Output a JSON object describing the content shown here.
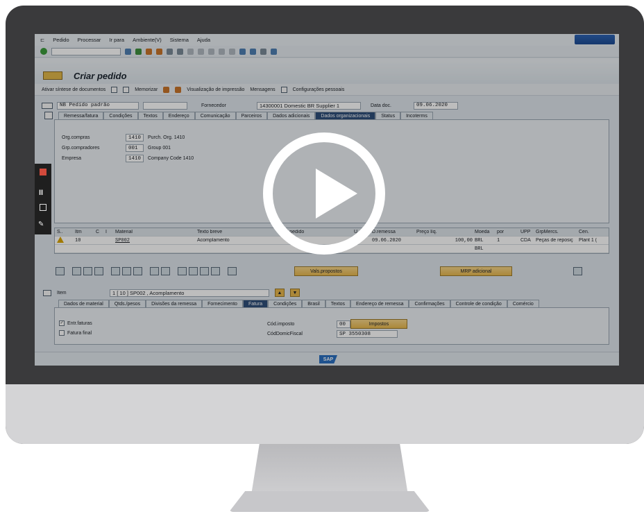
{
  "menu": [
    "Pedido",
    "Processar",
    "Ir para",
    "Ambiente(V)",
    "Sistema",
    "Ajuda"
  ],
  "title": "Criar pedido",
  "app_toolbar": {
    "doc_overview": "Ativar síntese de documentos",
    "hold": "Memorizar",
    "print_preview": "Visualização de impressão",
    "messages": "Mensagens",
    "personal_settings": "Configurações pessoais"
  },
  "header": {
    "order_type": "NB Pedido padrão",
    "supplier_label": "Fornecedor",
    "supplier_value": "14300001 Domestic BR Supplier 1",
    "doc_date_label": "Data doc.",
    "doc_date_value": "09.06.2020"
  },
  "header_tabs": [
    "Remessa/fatura",
    "Condições",
    "Textos",
    "Endereço",
    "Comunicação",
    "Parceiros",
    "Dados adicionais",
    "Dados organizacionais",
    "Status",
    "Incoterms"
  ],
  "org": [
    {
      "label": "Org.compras",
      "value": "1410",
      "desc": "Purch. Org. 1410"
    },
    {
      "label": "Grp.compradores",
      "value": "001",
      "desc": "Group 001"
    },
    {
      "label": "Empresa",
      "value": "1410",
      "desc": "Company Code 1410"
    }
  ],
  "items_table": {
    "headers": [
      "S..",
      "Itm",
      "C",
      "I",
      "Material",
      "Texto breve",
      "Qtd.pedido",
      "U..",
      "D.remessa",
      "Preço líq.",
      "Moeda",
      "por",
      "UPP",
      "GrpMercs.",
      "Cen."
    ],
    "rows": [
      [
        "",
        "10",
        "",
        "",
        "SP002",
        "Acomplamento",
        "",
        "",
        "09.06.2020",
        "100,00",
        "BRL",
        "1",
        "CDA",
        "Peças de reposiç",
        "Plant 1 ("
      ],
      [
        "",
        "",
        "",
        "",
        "",
        "",
        "",
        "",
        "",
        "",
        "BRL",
        "",
        "",
        "",
        ""
      ]
    ]
  },
  "buttons": {
    "proposals": "Vals.propostos",
    "mrp": "MRP adicional",
    "taxes": "Impostos"
  },
  "item_detail": {
    "label": "Item",
    "selector": "1 [ 10 ] SP002 , Acomplamento"
  },
  "item_tabs": [
    "Dados de material",
    "Qtds./pesos",
    "Divisões da remessa",
    "Fornecimento",
    "Fatura",
    "Condições",
    "Brasil",
    "Textos",
    "Endereço de remessa",
    "Confirmações",
    "Controle de condição",
    "Comércio"
  ],
  "invoice": {
    "inv_receipt": "Entr.faturas",
    "final_invoice": "Fatura final",
    "tax_code_label": "Cód.imposto",
    "tax_code_value": "00",
    "tax_juris_label": "CódDomicFiscal",
    "tax_juris_value": "SP 3550308"
  },
  "status_logo": "SAP",
  "colors": {
    "active_tab": "#2f4f7a",
    "sap_button": "#e8b84e",
    "play": "#ffffff",
    "record": "#d24a3c"
  }
}
